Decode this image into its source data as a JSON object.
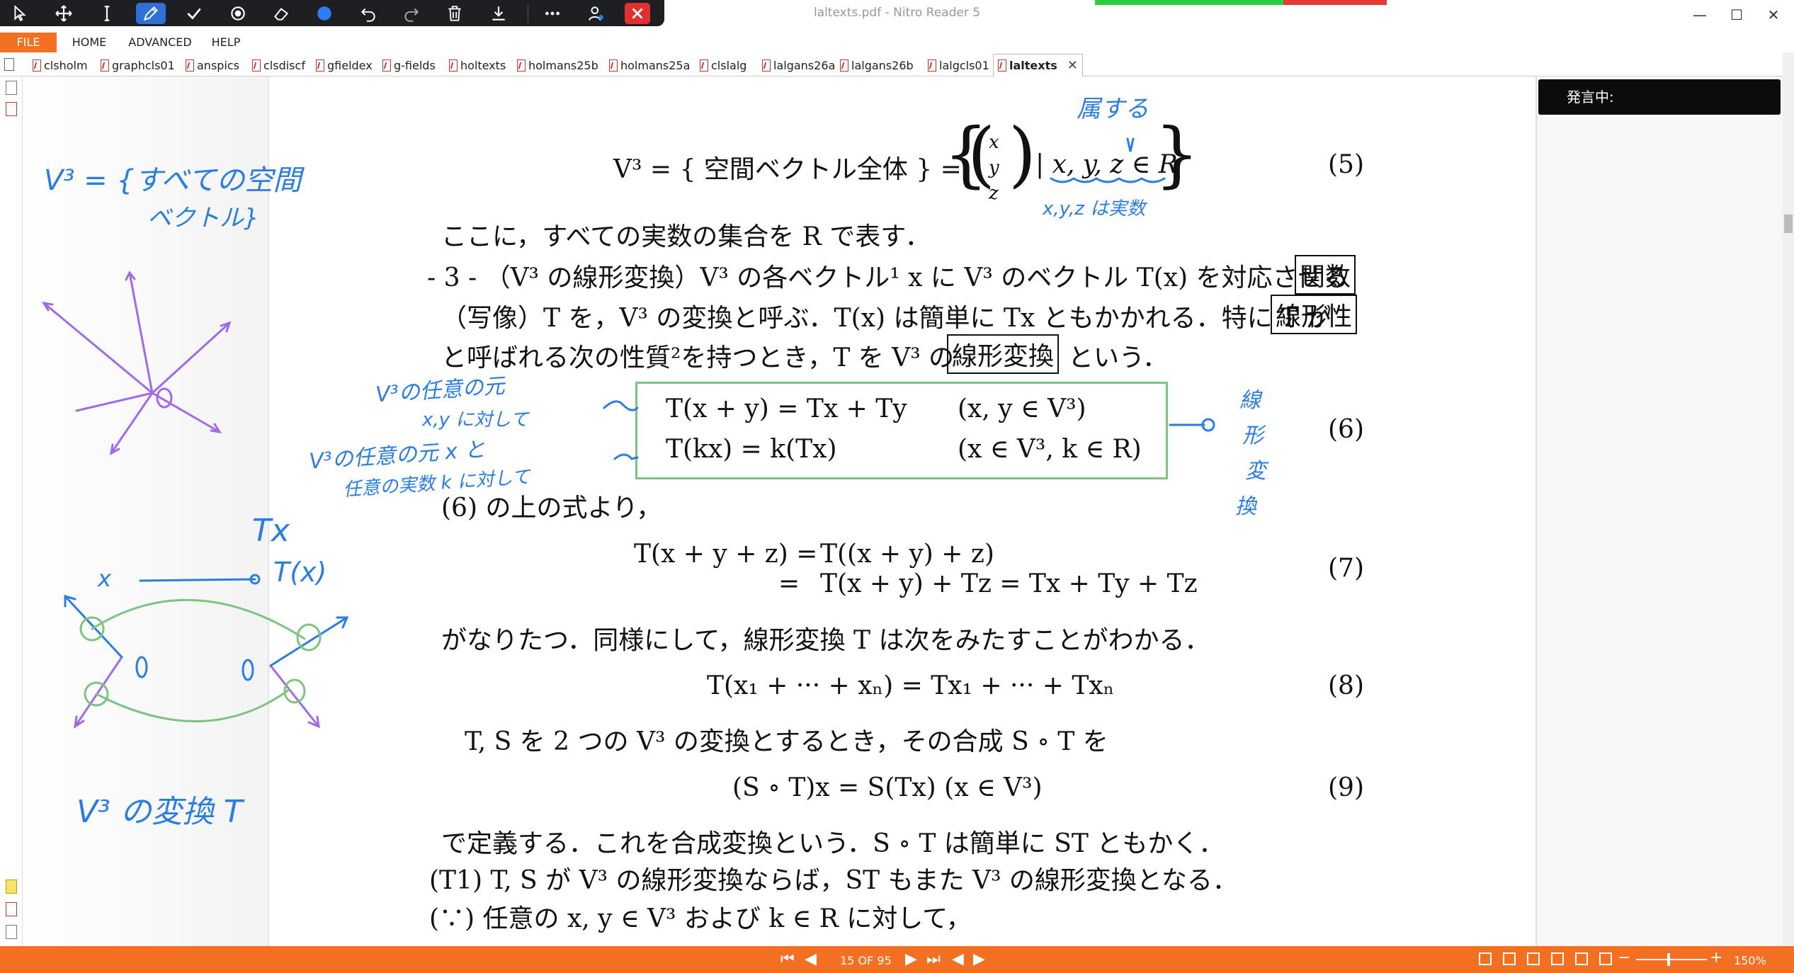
{
  "window": {
    "title": "laltexts.pdf - Nitro Reader 5",
    "minimize": "—",
    "maximize": "☐",
    "close": "✕"
  },
  "ribbon": {
    "tabs": [
      "FILE",
      "HOME",
      "ADVANCED",
      "HELP"
    ]
  },
  "doc_tabs": [
    "clsholm",
    "graphcls01",
    "anspics",
    "clsdiscf",
    "gfieldex",
    "g-fields",
    "holtexts",
    "holmans25b",
    "holmans25a",
    "clslalg",
    "lalgans26a",
    "lalgans26b",
    "lalgcls01"
  ],
  "active_tab": "laltexts",
  "pen_toolbar": {
    "icons": [
      "select-arrow-icon",
      "pan-icon",
      "text-cursor-icon",
      "pen-icon",
      "check-icon",
      "highlighter-icon",
      "eraser-icon",
      "color-dot-icon",
      "undo-icon",
      "redo-icon",
      "trash-icon",
      "download-icon",
      "more-icon",
      "settings-icon",
      "close-icon"
    ],
    "accent": "#2f6fd6"
  },
  "right_panel": {
    "speaking_label": "発言中:"
  },
  "status": {
    "page_info": "15 OF 95",
    "zoom": "150%"
  },
  "doc": {
    "eq5_lhs": "V³ = { 空間ベクトル全体 } =",
    "eq5_x": "x",
    "eq5_y": "y",
    "eq5_z": "z",
    "eq5_cond": "| x, y, z ∈ R",
    "eq5_no": "(5)",
    "line_here": "ここに，すべての実数の集合を R で表す．",
    "p3_a": "- 3 - （V³ の線形変換）V³ の各ベクトル¹ x に V³ のベクトル T(x) を対応させる",
    "p3_box1": "関数",
    "p3_b": "（写像）T を，V³ の変換と呼ぶ．T(x) は簡単に Tx ともかかれる．特に T が",
    "p3_box2": "線形性",
    "p3_c": "と呼ばれる次の性質²を持つとき，T を V³ の",
    "p3_box3": "線形変換",
    "p3_d": "という．",
    "eq6_l1": "T(x + y) = Tx + Ty",
    "eq6_r1": "(x, y ∈ V³)",
    "eq6_l2": "T(kx) = k(Tx)",
    "eq6_r2": "(x ∈ V³, k ∈ R)",
    "eq6_no": "(6)",
    "line_from6": "(6) の上の式より，",
    "eq7_l1": "T(x + y + z) =",
    "eq7_r1": "T((x + y) + z)",
    "eq7_l2": "=",
    "eq7_r2": "T(x + y) + Tz = Tx + Ty + Tz",
    "eq7_no": "(7)",
    "line_holds": "がなりたつ．同様にして，線形変換 T は次をみたすことがわかる．",
    "eq8": "T(x₁ + ··· + xₙ) = Tx₁ + ··· + Txₙ",
    "eq8_no": "(8)",
    "line_ts": "T, S を 2 つの V³ の変換とするとき，その合成 S ∘ T を",
    "eq9": "(S ∘ T)x = S(Tx)        (x ∈ V³)",
    "eq9_no": "(9)",
    "line_def": "で定義する．これを合成変換という．S ∘ T は簡単に ST ともかく．",
    "line_t1": "(T1) T, S が V³ の線形変換ならば，ST もまた V³ の線形変換となる．",
    "line_since": "(∵) 任意の x, y ∈ V³ および k ∈ R に対して，"
  },
  "annotations": {
    "v3_all_1": "V³ = {すべての空間",
    "v3_all_2": "ベクトル}",
    "belongs": "属する",
    "xyz_real": "x,y,z は実数",
    "anyelem_1": "V³の任意の元",
    "anyelem_2": "x,y に対して",
    "anyelem_3": "V³の任意の元 x と",
    "anyelem_4": "任意の実数 k に対して",
    "linear_1": "線",
    "linear_2": "形",
    "linear_3": "変",
    "linear_4": "換",
    "tx_1": "Tx",
    "tx_2": "T(x)",
    "x_label": "x",
    "zero_1": "0",
    "zero_2": "0",
    "zero_3": "0",
    "v3_transform": "V³ の変換 T",
    "ink_color": "#2a7de1",
    "purple": "#a36ae6",
    "green": "#7cc47f"
  }
}
